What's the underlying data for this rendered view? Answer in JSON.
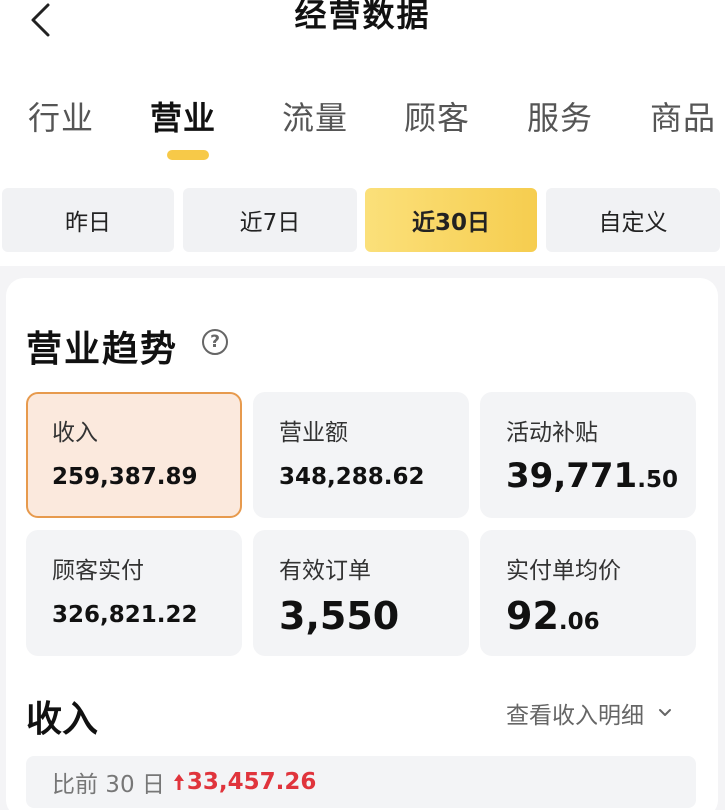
{
  "header": {
    "title": "经营数据",
    "back_icon": "chevron-left-icon"
  },
  "tabs": [
    {
      "label": "行业",
      "active": false
    },
    {
      "label": "营业",
      "active": true
    },
    {
      "label": "流量",
      "active": false
    },
    {
      "label": "顾客",
      "active": false
    },
    {
      "label": "服务",
      "active": false
    },
    {
      "label": "商品",
      "active": false
    }
  ],
  "periods": [
    {
      "label": "昨日",
      "active": false
    },
    {
      "label": "近7日",
      "active": false
    },
    {
      "label": "近30日",
      "active": true
    },
    {
      "label": "自定义",
      "active": false
    }
  ],
  "trend": {
    "title": "营业趋势",
    "help_icon": "question-circle-icon",
    "metrics": [
      {
        "label": "收入",
        "value": "259,387.89",
        "active": true
      },
      {
        "label": "营业额",
        "value": "348,288.62",
        "active": false
      },
      {
        "label": "活动补贴",
        "value_int": "39,771",
        "value_dec": ".50",
        "active": false
      },
      {
        "label": "顾客实付",
        "value": "326,821.22",
        "active": false
      },
      {
        "label": "有效订单",
        "value": "3,550",
        "active": false
      },
      {
        "label": "实付单均价",
        "value_int": "92",
        "value_dec": ".06",
        "active": false
      }
    ]
  },
  "income": {
    "title": "收入",
    "detail_label": "查看收入明细",
    "compare_label": "比前 30 日",
    "compare_value": "33,457.26",
    "compare_icon": "arrow-up-icon"
  },
  "colors": {
    "accent_yellow": "#f7c948",
    "active_metric_bg": "#fbe9dd",
    "active_metric_border": "#e79a4d",
    "increase_red": "#e0343c"
  }
}
